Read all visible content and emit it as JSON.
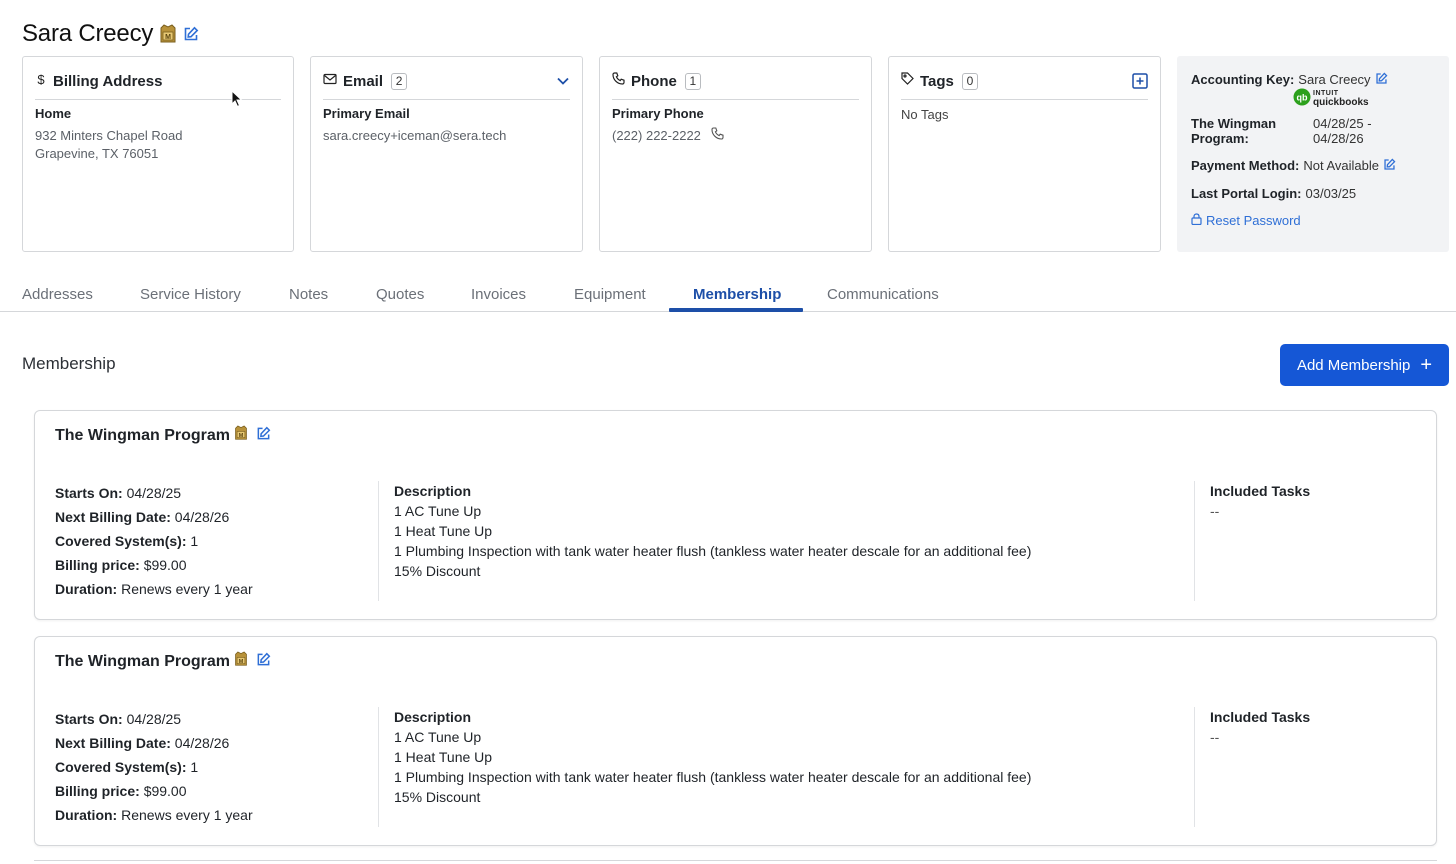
{
  "customer": {
    "name": "Sara Creecy"
  },
  "billing": {
    "title": "Billing Address",
    "label": "Home",
    "line1": "932 Minters Chapel Road",
    "line2": "Grapevine, TX 76051"
  },
  "email": {
    "title": "Email",
    "count": "2",
    "label": "Primary Email",
    "value": "sara.creecy+iceman@sera.tech"
  },
  "phone": {
    "title": "Phone",
    "count": "1",
    "label": "Primary Phone",
    "value": "(222) 222-2222"
  },
  "tags": {
    "title": "Tags",
    "count": "0",
    "empty": "No Tags"
  },
  "accounting": {
    "key_label": "Accounting Key:",
    "key_value": "Sara Creecy",
    "qb_small": "INTUIT",
    "qb_brand": "quickbooks",
    "program_label": "The Wingman Program:",
    "program_value": "04/28/25 - 04/28/26",
    "payment_label": "Payment Method:",
    "payment_value": "Not Available",
    "login_label": "Last Portal Login:",
    "login_value": "03/03/25",
    "reset": "Reset Password"
  },
  "tabs": [
    {
      "label": "Addresses"
    },
    {
      "label": "Service History"
    },
    {
      "label": "Notes"
    },
    {
      "label": "Quotes"
    },
    {
      "label": "Invoices"
    },
    {
      "label": "Equipment"
    },
    {
      "label": "Membership"
    },
    {
      "label": "Communications"
    }
  ],
  "active_tab": "Membership",
  "section": {
    "title": "Membership",
    "add_button": "Add Membership",
    "add_icon": "+"
  },
  "memberships": [
    {
      "name": "The Wingman Program",
      "starts_label": "Starts On:",
      "starts": "04/28/25",
      "next_label": "Next Billing Date:",
      "next": "04/28/26",
      "covered_label": "Covered System(s):",
      "covered": "1",
      "price_label": "Billing price:",
      "price": "$99.00",
      "duration_label": "Duration:",
      "duration": "Renews every 1 year",
      "desc_label": "Description",
      "desc": [
        "1 AC Tune Up",
        "1 Heat Tune Up",
        "1 Plumbing Inspection with tank water heater flush (tankless water heater descale for an additional fee)",
        "15% Discount"
      ],
      "tasks_label": "Included Tasks",
      "tasks": "--"
    },
    {
      "name": "The Wingman Program",
      "starts_label": "Starts On:",
      "starts": "04/28/25",
      "next_label": "Next Billing Date:",
      "next": "04/28/26",
      "covered_label": "Covered System(s):",
      "covered": "1",
      "price_label": "Billing price:",
      "price": "$99.00",
      "duration_label": "Duration:",
      "duration": "Renews every 1 year",
      "desc_label": "Description",
      "desc": [
        "1 AC Tune Up",
        "1 Heat Tune Up",
        "1 Plumbing Inspection with tank water heater flush (tankless water heater descale for an additional fee)",
        "15% Discount"
      ],
      "tasks_label": "Included Tasks",
      "tasks": "--"
    }
  ],
  "colors": {
    "accent": "#1557d6",
    "tab_active": "#1d4fa8",
    "link": "#2f6fd6",
    "badge_gold": "#b8923a"
  }
}
